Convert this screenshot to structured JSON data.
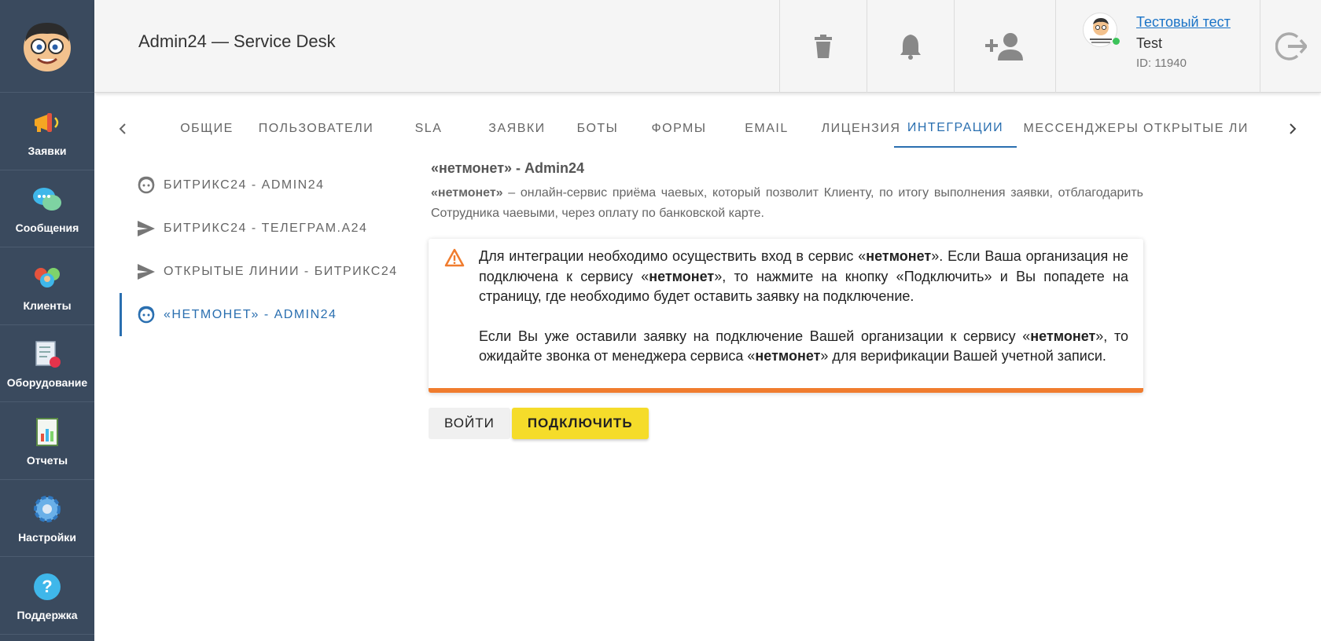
{
  "app": {
    "title": "Admin24 — Service Desk"
  },
  "sidebar": {
    "items": [
      {
        "label": "Заявки",
        "icon": "megaphone-icon"
      },
      {
        "label": "Сообщения",
        "icon": "chat-bubbles-icon"
      },
      {
        "label": "Клиенты",
        "icon": "clients-icon"
      },
      {
        "label": "Оборудование",
        "icon": "equipment-icon"
      },
      {
        "label": "Отчеты",
        "icon": "reports-icon"
      },
      {
        "label": "Настройки",
        "icon": "gear-icon"
      },
      {
        "label": "Поддержка",
        "icon": "help-icon"
      }
    ]
  },
  "header": {
    "user": {
      "name": "Тестовый тест",
      "login": "Test",
      "id": "ID: 11940"
    }
  },
  "tabs": [
    "Общие",
    "Пользователи",
    "SLA",
    "Заявки",
    "Боты",
    "Формы",
    "Email",
    "Лицензия",
    "Интеграции",
    "Мессенджеры",
    "Открытые ли"
  ],
  "integrations": [
    {
      "label": "Битрикс24 - Admin24"
    },
    {
      "label": "Битрикс24 - Телеграм.А24"
    },
    {
      "label": "Открытые линии - Битрикс24"
    },
    {
      "label": "«нетмонет» - Admin24"
    }
  ],
  "content": {
    "title": "«нетмонет» - Admin24",
    "desc_brand": "«нетмонет»",
    "desc_text": " – онлайн-сервис приёма чаевых, который позволит Клиенту, по итогу выполнения заявки, отблагодарить Сотрудника чаевыми, через оплату по банковской карте.",
    "alert": {
      "p1_a": "Для интеграции необходимо осуществить вход в сервис «",
      "brand": "нетмонет",
      "p1_b": "». Если Ваша организация не подключена к сервису «",
      "p1_c": "», то нажмите на кнопку «Подключить» и Вы попадете на страницу, где необходимо будет оставить заявку на подключение.",
      "p2_a": "Если Вы уже оставили заявку на подключение Вашей организации к сервису «",
      "p2_b": "», то ожидайте звонка от менеджера сервиса «",
      "p2_c": "» для верификации Вашей учетной записи."
    },
    "buttons": {
      "login": "ВОЙТИ",
      "connect": "ПОДКЛЮЧИТЬ"
    }
  },
  "colors": {
    "accent": "#2a6fb0",
    "warning": "#f07c2e",
    "button_yellow": "#f5dc2a",
    "sidebar": "#3a4a5e"
  }
}
